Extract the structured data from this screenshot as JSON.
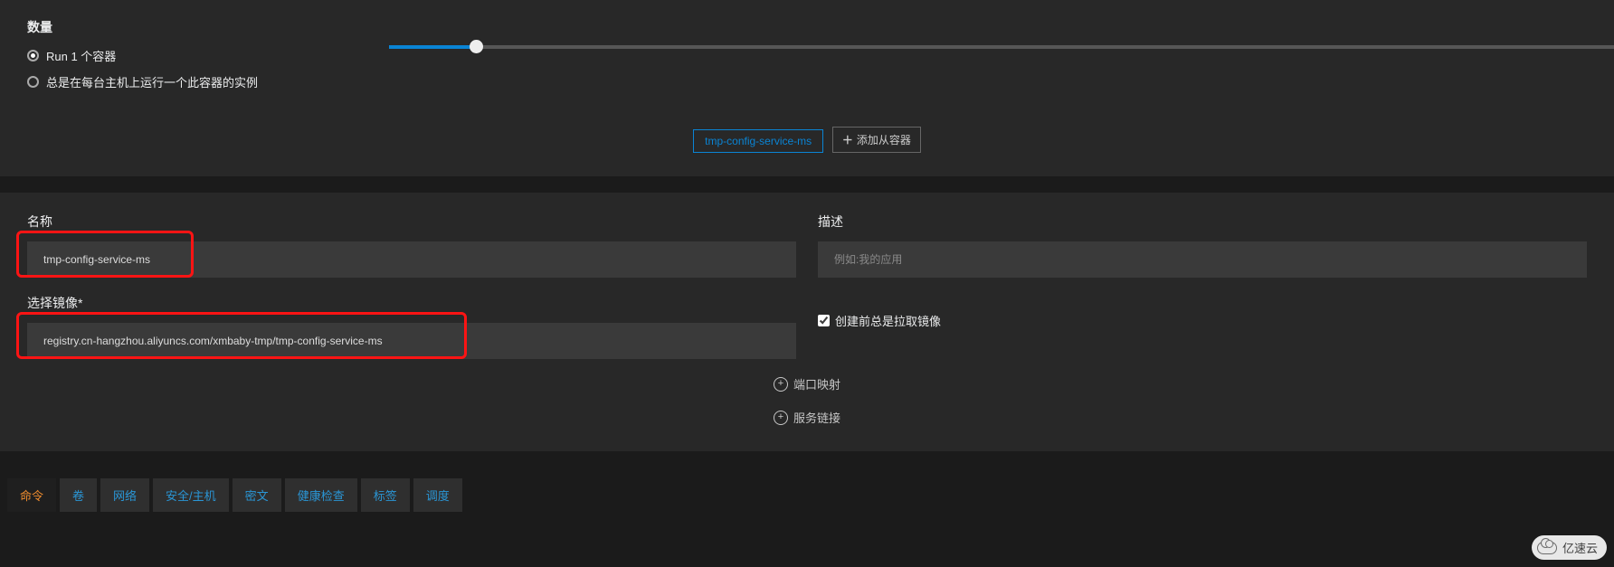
{
  "quantity": {
    "title": "数量",
    "options": {
      "run_n": "Run 1 个容器",
      "always_one": "总是在每台主机上运行一个此容器的实例"
    },
    "selected": "run_n"
  },
  "container_pills": {
    "primary": "tmp-config-service-ms",
    "add_secondary": "添加从容器"
  },
  "form": {
    "name": {
      "label": "名称",
      "value": "tmp-config-service-ms"
    },
    "description": {
      "label": "描述",
      "placeholder": "例如:我的应用"
    },
    "image": {
      "label": "选择镜像*",
      "value": "registry.cn-hangzhou.aliyuncs.com/xmbaby-tmp/tmp-config-service-ms"
    },
    "always_pull": {
      "label": "创建前总是拉取镜像",
      "checked": true
    },
    "links": {
      "port_map": "端口映射",
      "service_link": "服务链接"
    }
  },
  "tabs": {
    "items": [
      "命令",
      "卷",
      "网络",
      "安全/主机",
      "密文",
      "健康检查",
      "标签",
      "调度"
    ],
    "active": 0
  },
  "watermark": "亿速云"
}
